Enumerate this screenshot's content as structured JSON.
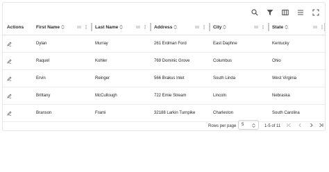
{
  "toolbar": {
    "icons": [
      "search-icon",
      "filter-icon",
      "columns-icon",
      "density-icon",
      "fullscreen-icon"
    ]
  },
  "columns": [
    {
      "key": "actions",
      "label": "Actions"
    },
    {
      "key": "first_name",
      "label": "First Name"
    },
    {
      "key": "last_name",
      "label": "Last Name"
    },
    {
      "key": "address",
      "label": "Address"
    },
    {
      "key": "city",
      "label": "City"
    },
    {
      "key": "state",
      "label": "State"
    }
  ],
  "rows": [
    {
      "first_name": "Dylan",
      "last_name": "Murray",
      "address": "261 Erdman Ford",
      "city": "East Daphne",
      "state": "Kentucky"
    },
    {
      "first_name": "Raquel",
      "last_name": "Kohler",
      "address": "769 Dominic Grove",
      "city": "Columbus",
      "state": "Ohio"
    },
    {
      "first_name": "Ervin",
      "last_name": "Reinger",
      "address": "566 Brakus Inlet",
      "city": "South Linda",
      "state": "West Virginia"
    },
    {
      "first_name": "Brittany",
      "last_name": "McCullough",
      "address": "722 Emie Stream",
      "city": "Lincoln",
      "state": "Nebraska"
    },
    {
      "first_name": "Branson",
      "last_name": "Frami",
      "address": "32188 Larkin Turnpike",
      "city": "Charleston",
      "state": "South Carolina"
    }
  ],
  "footer": {
    "rows_per_page_label": "Rows per page",
    "rows_per_page_value": "5",
    "page_range": "1-5 of 11"
  },
  "colors": {
    "border": "#e2e2e2",
    "icon": "#555555",
    "resize_handle": "#c8c8c8"
  }
}
